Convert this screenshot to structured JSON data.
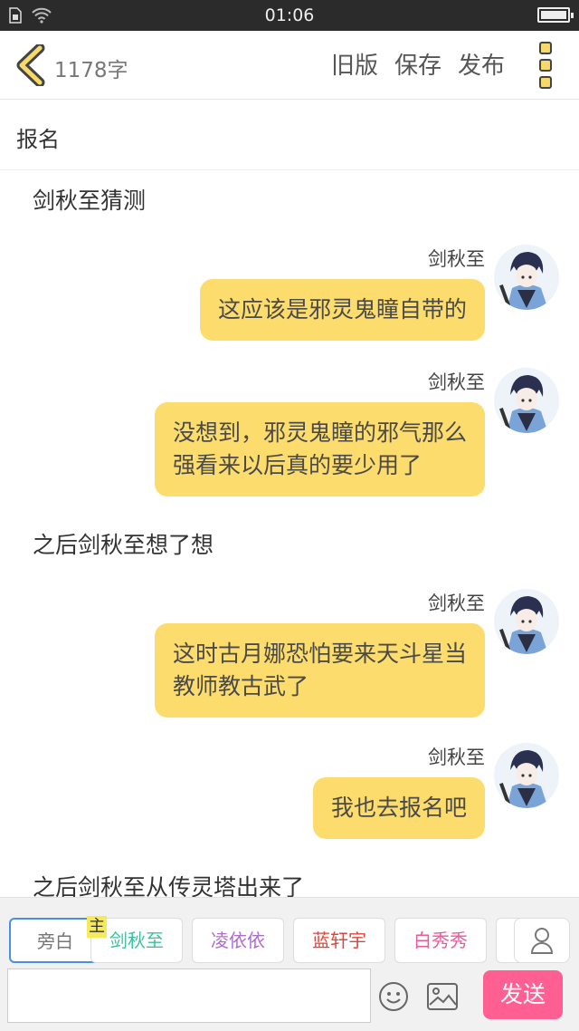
{
  "status_bar": {
    "time": "01:06"
  },
  "header": {
    "word_count": "1178字",
    "old_version": "旧版",
    "save": "保存",
    "publish": "发布"
  },
  "chapter_title": "报名",
  "story": [
    {
      "kind": "narration",
      "text": "剑秋至猜测"
    },
    {
      "kind": "message",
      "name": "剑秋至",
      "lines": [
        "这应该是邪灵鬼瞳自带的"
      ]
    },
    {
      "kind": "message",
      "name": "剑秋至",
      "lines": [
        "没想到，邪灵鬼瞳的邪气那么",
        "强看来以后真的要少用了"
      ]
    },
    {
      "kind": "narration",
      "text": "之后剑秋至想了想"
    },
    {
      "kind": "message",
      "name": "剑秋至",
      "lines": [
        "这时古月娜恐怕要来天斗星当",
        "教师教古武了"
      ]
    },
    {
      "kind": "message",
      "name": "剑秋至",
      "lines": [
        "我也去报名吧"
      ]
    },
    {
      "kind": "narration",
      "text": "之后剑秋至从传灵塔出来了"
    }
  ],
  "roles": [
    {
      "label": "旁白",
      "color": "#777777"
    },
    {
      "label": "剑秋至",
      "color": "#3cc0a0"
    },
    {
      "label": "凌依依",
      "color": "#b06ad0"
    },
    {
      "label": "蓝轩宇",
      "color": "#e0443a"
    },
    {
      "label": "白秀秀",
      "color": "#e85a9a"
    }
  ],
  "main_role_badge": "主",
  "input": {
    "value": ""
  },
  "send_label": "发送"
}
